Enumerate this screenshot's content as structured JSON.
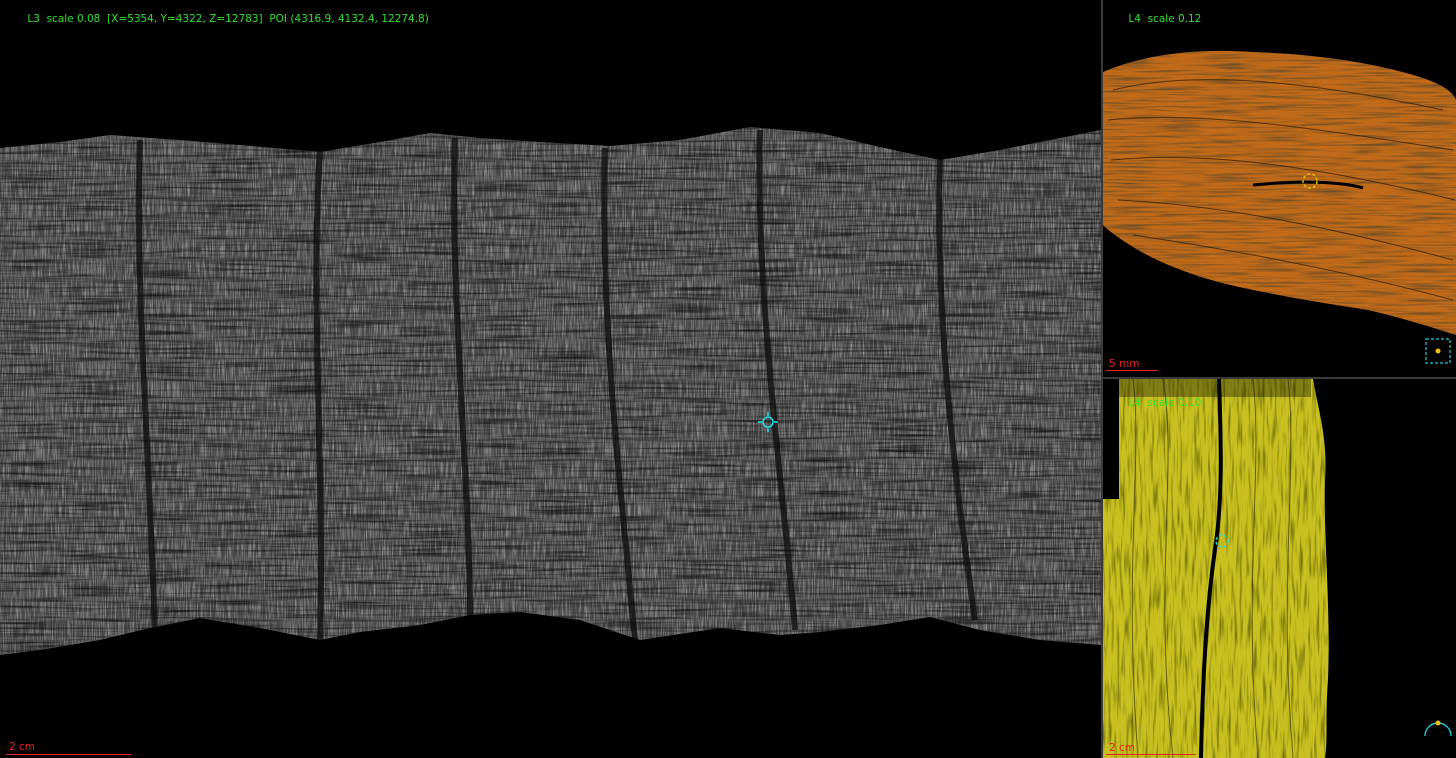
{
  "main_view": {
    "level": "L3",
    "scale": "scale 0.08",
    "coords": "[X=5354, Y=4322, Z=12783]",
    "poi": "POI (4316.9, 4132.4, 12274.8)",
    "scale_bar_label": "2 cm",
    "crosshair_icon": "crosshair-icon"
  },
  "top_right_view": {
    "level": "L4",
    "scale": "scale 0.12",
    "scale_bar_label": "5 mm",
    "poi_marker_icon": "circle-marker-icon",
    "nav_icon": "view-selector-icon"
  },
  "bottom_right_view": {
    "level": "L4",
    "scale": "scale 0.10",
    "scale_bar_label": "2 cm",
    "poi_marker_icon": "circle-marker-icon",
    "nav_icon": "arc-orientation-icon"
  },
  "colors": {
    "label_green": "#2ee02e",
    "scale_red": "#e82020",
    "marker_cyan": "#20d8e0",
    "texture_gray": "#4a4a4a",
    "orange_slice": "#c06a1a",
    "yellow_slice": "#c8c020"
  }
}
